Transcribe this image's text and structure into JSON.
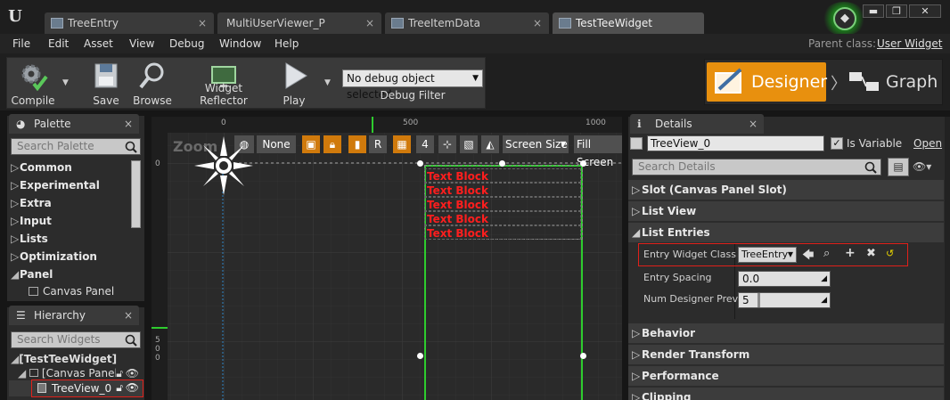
{
  "tabs": [
    {
      "label": "TreeEntry",
      "active": false
    },
    {
      "label": "MultiUserViewer_P",
      "active": false
    },
    {
      "label": "TreeItemData",
      "active": false
    },
    {
      "label": "TestTeeWidget",
      "active": true
    }
  ],
  "window_controls": {
    "minimize": "▬",
    "maximize": "❐",
    "close": "✕"
  },
  "menu": [
    "File",
    "Edit",
    "Asset",
    "View",
    "Debug",
    "Window",
    "Help"
  ],
  "parent_class": {
    "label": "Parent class:",
    "value": "User Widget"
  },
  "toolbar": {
    "compile": "Compile",
    "save": "Save",
    "browse": "Browse",
    "widget_reflector": "Widget Reflector",
    "play": "Play",
    "debug_select": "No debug object selected",
    "debug_filter": "Debug Filter"
  },
  "modes": {
    "designer": "Designer",
    "graph": "Graph"
  },
  "palette": {
    "title": "Palette",
    "search_placeholder": "Search Palette",
    "categories": [
      {
        "label": "Common",
        "expanded": false
      },
      {
        "label": "Experimental",
        "expanded": false
      },
      {
        "label": "Extra",
        "expanded": false
      },
      {
        "label": "Input",
        "expanded": false
      },
      {
        "label": "Lists",
        "expanded": false
      },
      {
        "label": "Optimization",
        "expanded": false
      },
      {
        "label": "Panel",
        "expanded": true
      }
    ],
    "items": [
      "Canvas Panel"
    ]
  },
  "hierarchy": {
    "title": "Hierarchy",
    "search_placeholder": "Search Widgets",
    "nodes": [
      "[TestTeeWidget]",
      "[Canvas Panel]",
      "TreeView_0"
    ]
  },
  "viewport": {
    "zoom_label": "Zoom",
    "ruler_top": [
      "0",
      "500",
      "1000"
    ],
    "ruler_left": [
      "0",
      "5",
      "0",
      "0"
    ],
    "controls": {
      "none": "None",
      "r_button": "R",
      "grid_value": "4",
      "screen_size": "Screen Size",
      "fill_screen": "Fill Screen"
    },
    "text_blocks": [
      "Text Block",
      "Text Block",
      "Text Block",
      "Text Block",
      "Text Block"
    ]
  },
  "details": {
    "title": "Details",
    "name_value": "TreeView_0",
    "is_variable_label": "Is Variable",
    "is_variable": true,
    "open_label": "Open",
    "search_placeholder": "Search Details",
    "sections": {
      "slot": "Slot (Canvas Panel Slot)",
      "list_view": "List View",
      "list_entries": "List Entries",
      "behavior": "Behavior",
      "render_transform": "Render Transform",
      "performance": "Performance",
      "clipping": "Clipping"
    },
    "props": {
      "entry_widget_class": {
        "label": "Entry Widget Class",
        "value": "TreeEntry"
      },
      "entry_spacing": {
        "label": "Entry Spacing",
        "value": "0.0"
      },
      "num_designer_preview": {
        "label": "Num Designer Previ",
        "value": "5"
      }
    }
  },
  "colors": {
    "accent": "#e8900e",
    "selection_green": "#2ecc2e",
    "text_block_red": "#ff1e1e",
    "highlight_red": "#e0201a"
  }
}
